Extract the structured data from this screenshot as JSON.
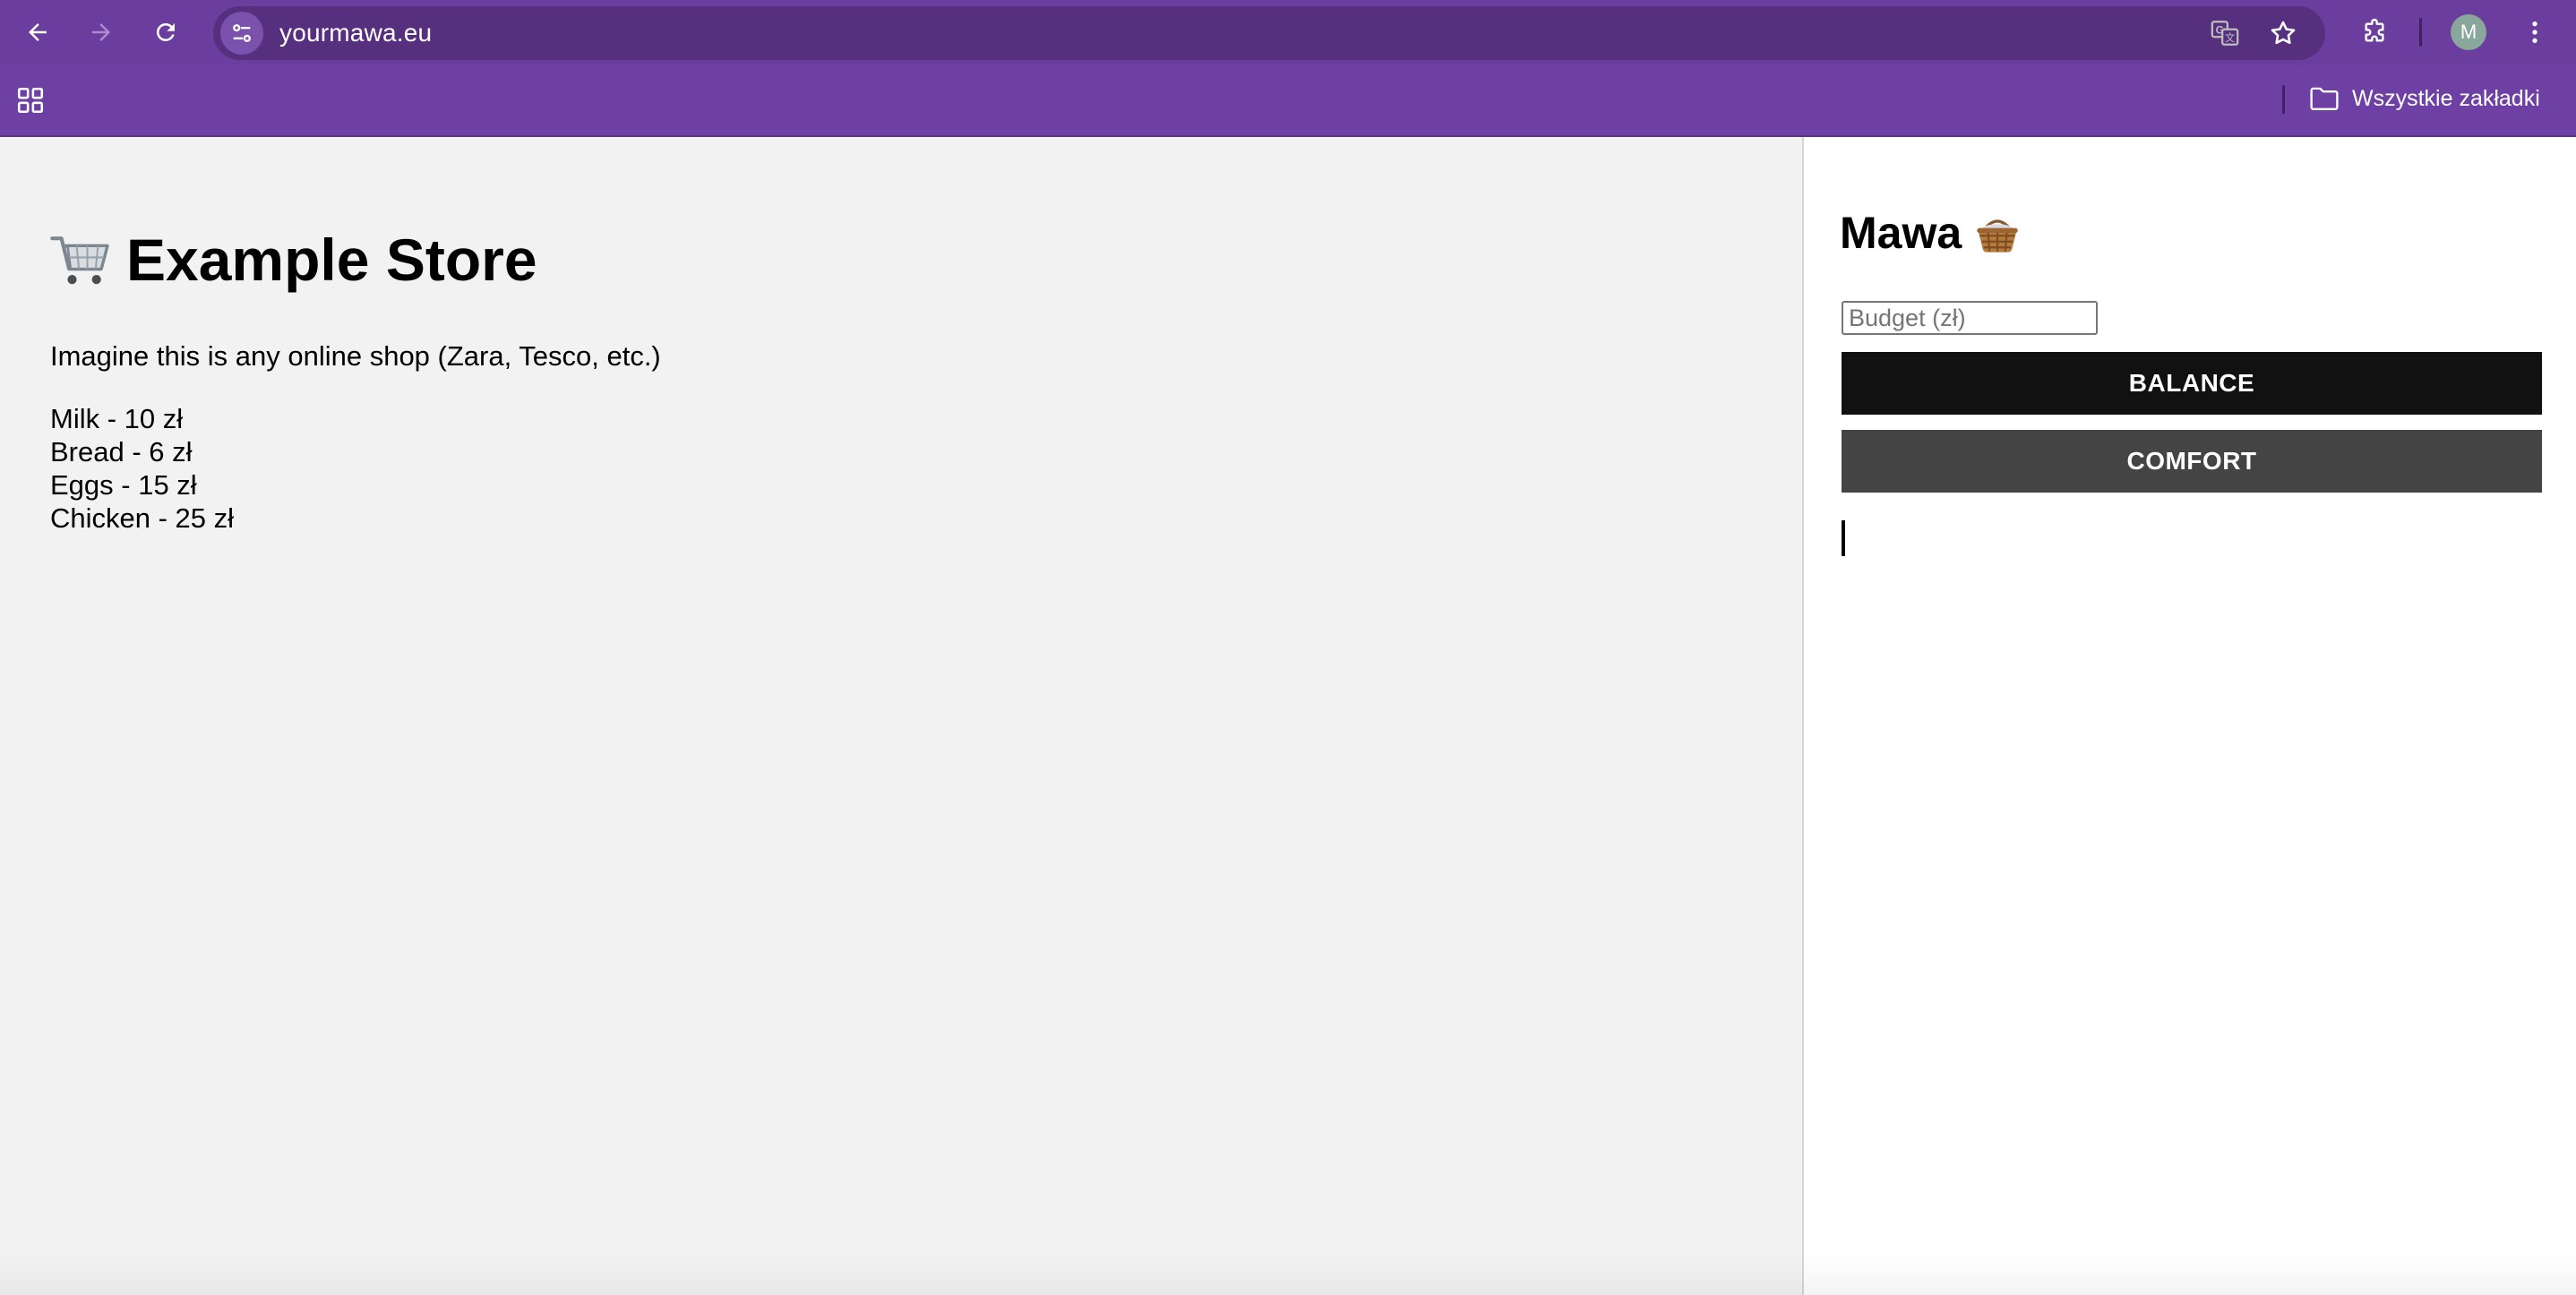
{
  "browser": {
    "url": "yourmawa.eu",
    "profile_initial": "M",
    "bookmarks_folder_label": "Wszystkie zakładki",
    "accent_color": "#6a3d9e"
  },
  "store": {
    "title": "Example Store",
    "description": "Imagine this is any online shop (Zara, Tesco, etc.)",
    "products": [
      "Milk - 10 zł",
      "Bread - 6 zł",
      "Eggs - 15 zł",
      "Chicken - 25 zł"
    ]
  },
  "mawa": {
    "title": "Mawa",
    "budget_placeholder": "Budget (zł)",
    "balance_label": "BALANCE",
    "comfort_label": "COMFORT"
  },
  "icons": [
    "back-arrow-icon",
    "forward-arrow-icon",
    "reload-icon",
    "site-info-icon",
    "translate-icon",
    "star-icon",
    "extensions-icon",
    "kebab-menu-icon",
    "apps-grid-icon",
    "folder-icon",
    "shopping-cart-icon",
    "basket-icon"
  ]
}
